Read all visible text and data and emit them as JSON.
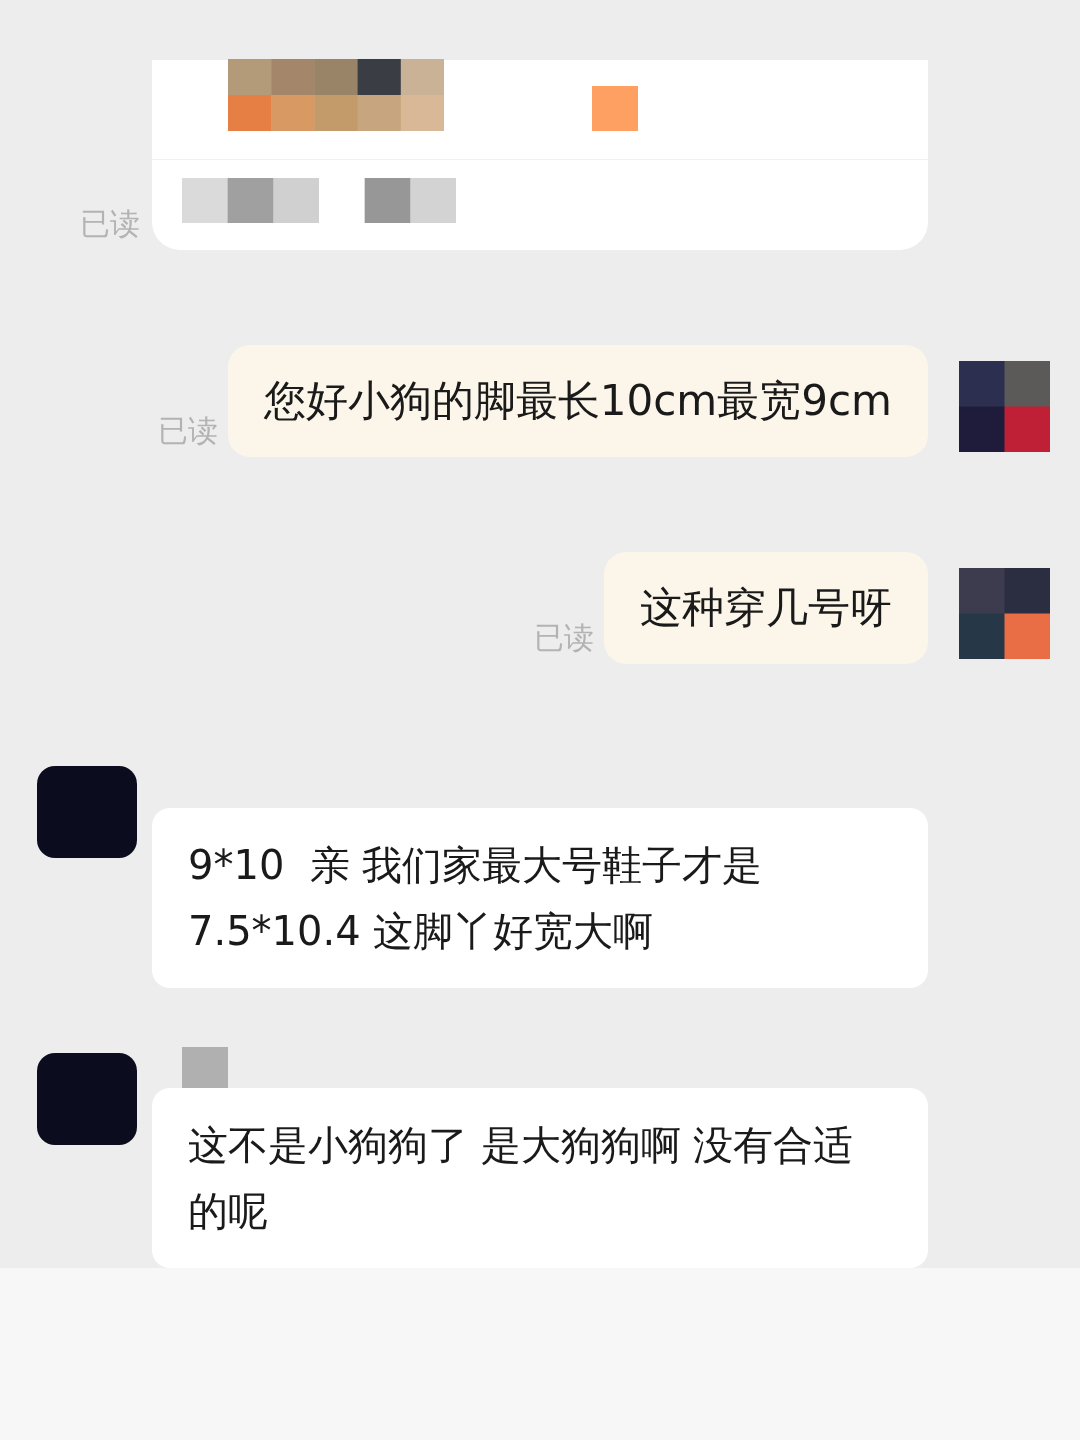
{
  "messages": [
    {
      "kind": "card",
      "read_label": "已读"
    },
    {
      "kind": "outgoing",
      "text": "您好小狗的脚最长10cm最宽9cm",
      "read_label": "已读"
    },
    {
      "kind": "outgoing",
      "text": "这种穿几号呀",
      "read_label": "已读"
    },
    {
      "kind": "incoming",
      "text": "9*10  亲 我们家最大号鞋子才是 7.5*10.4 这脚丫好宽大啊"
    },
    {
      "kind": "incoming",
      "text": "这不是小狗狗了 是大狗狗啊 没有合适的呢",
      "name_hidden": true
    }
  ]
}
